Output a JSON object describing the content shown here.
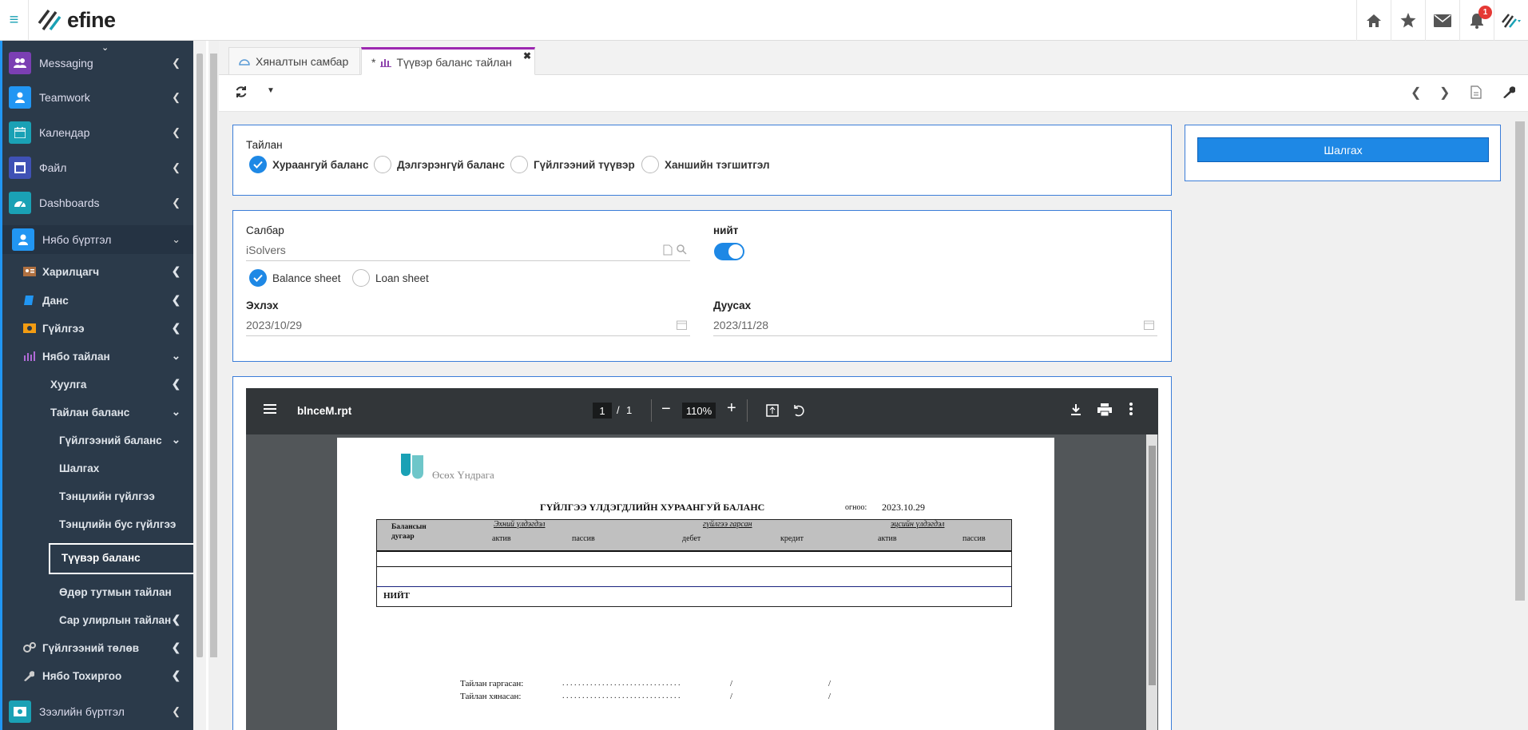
{
  "app": {
    "name": "efine"
  },
  "topbar": {
    "notification_count": "1"
  },
  "sidebar": {
    "items": [
      {
        "label": "Messaging",
        "color": "#7b3fb3"
      },
      {
        "label": "Teamwork",
        "color": "#2196f3"
      },
      {
        "label": "Календар",
        "color": "#1aa1b5"
      },
      {
        "label": "Файл",
        "color": "#3f51b5"
      },
      {
        "label": "Dashboards",
        "color": "#1aa1b5"
      },
      {
        "label": "Нябо бүртгэл",
        "color": "#2196f3"
      }
    ],
    "sub_items": [
      {
        "label": "Харилцагч"
      },
      {
        "label": "Данс"
      },
      {
        "label": "Гүйлгээ"
      },
      {
        "label": "Нябо тайлан"
      },
      {
        "label": "Хуулга"
      },
      {
        "label": "Тайлан баланс"
      },
      {
        "label": "Гүйлгээний баланс"
      },
      {
        "label": "Шалгах"
      },
      {
        "label": "Тэнцлийн гүйлгээ"
      },
      {
        "label": "Тэнцлийн бус гүйлгээ"
      },
      {
        "label": "Түүвэр баланс"
      },
      {
        "label": "Өдөр тутмын тайлан"
      },
      {
        "label": "Сар улирлын тайлан"
      },
      {
        "label": "Гүйлгээний төлөв"
      },
      {
        "label": "Нябо Тохиргоо"
      }
    ],
    "bottom_item": {
      "label": "Зээлийн бүртгэл"
    }
  },
  "tabs": [
    {
      "label": "Хяналтын самбар"
    },
    {
      "label": "Түүвэр баланс тайлан",
      "prefix": "*"
    }
  ],
  "form": {
    "report_label": "Тайлан",
    "report_options": [
      "Хураангуй баланс",
      "Дэлгэрэнгүй баланс",
      "Гүйлгээний түүвэр",
      "Ханшийн тэгшитгэл"
    ],
    "branch_label": "Салбар",
    "branch_value": "iSolvers",
    "total_label": "нийт",
    "sheet_options": [
      "Balance sheet",
      "Loan sheet"
    ],
    "start_label": "Эхлэх",
    "start_value": "2023/10/29",
    "end_label": "Дуусах",
    "end_value": "2023/11/28",
    "check_button": "Шалгах"
  },
  "pdf": {
    "filename": "blnceM.rpt",
    "page_current": "1",
    "page_sep": "/",
    "page_total": "1",
    "zoom": "110%"
  },
  "report": {
    "company": "Өсөх Үндрага",
    "title": "ГҮЙЛГЭЭ ҮЛДЭГДЛИЙН ХУРААНГУЙ БАЛАНС",
    "date_label": "огноо:",
    "date_value": "2023.10.29",
    "col_account": "Балансын дугаар",
    "group1": "Эхний үлдэгдэл",
    "group2": "гүйлгээ гарсан",
    "group3": "эцсийн үлдэгдэл",
    "sub_asset": "актив",
    "sub_liab": "пассив",
    "sub_debit": "дебет",
    "sub_credit": "кредит",
    "total_label": "НИЙТ",
    "prepared_label": "Тайлан гаргасан:",
    "reviewed_label": "Тайлан хянасан:",
    "dots": ". . . . . . . . . . . . . . . . . . . . . . . . . . . . . .",
    "slash": "/"
  }
}
